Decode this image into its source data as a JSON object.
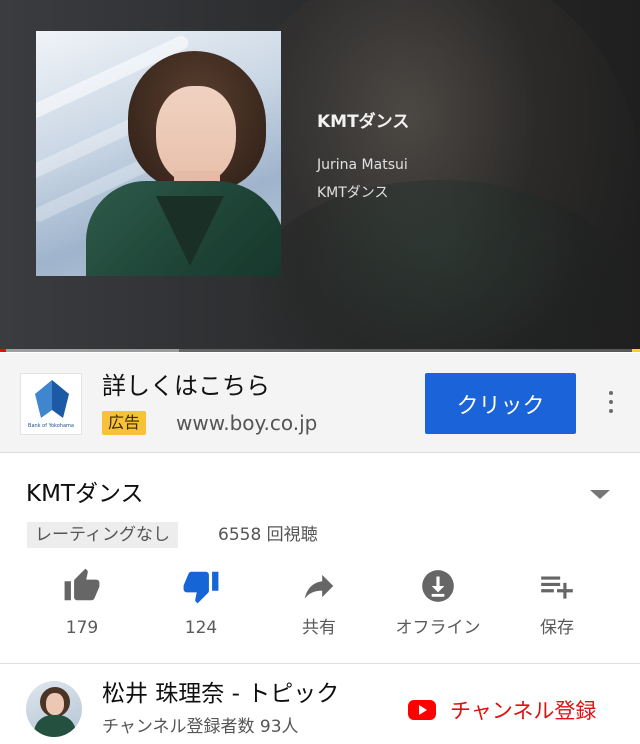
{
  "player": {
    "track_title": "KMTダンス",
    "artist": "Jurina Matsui",
    "album": "KMTダンス",
    "progress_fraction": 0.01,
    "buffered_fraction": 0.28,
    "colors": {
      "played": "#ff0000",
      "ad_marker": "#ffd400"
    }
  },
  "ad": {
    "logo_icon": "bank-logo-icon",
    "logo_text": "Bank of Yokohama",
    "headline": "詳しくはこちら",
    "badge": "広告",
    "url": "www.boy.co.jp",
    "cta_label": "クリック",
    "menu_icon": "more-vert-icon",
    "colors": {
      "cta": "#1a63d8",
      "badge": "#f7c23a"
    }
  },
  "video": {
    "title": "KMTダンス",
    "rating": "レーティングなし",
    "views": "6558 回視聴"
  },
  "actions": [
    {
      "icon": "thumbs-up-icon",
      "label": "179"
    },
    {
      "icon": "thumbs-down-icon",
      "label": "124",
      "active": true
    },
    {
      "icon": "share-icon",
      "label": "共有"
    },
    {
      "icon": "download-icon",
      "label": "オフライン"
    },
    {
      "icon": "playlist-add-icon",
      "label": "保存"
    }
  ],
  "channel": {
    "name": "松井 珠理奈 - トピック",
    "subscribers": "チャンネル登録者数 93人",
    "subscribe_label": "チャンネル登録",
    "colors": {
      "subscribe": "#e01010"
    }
  }
}
